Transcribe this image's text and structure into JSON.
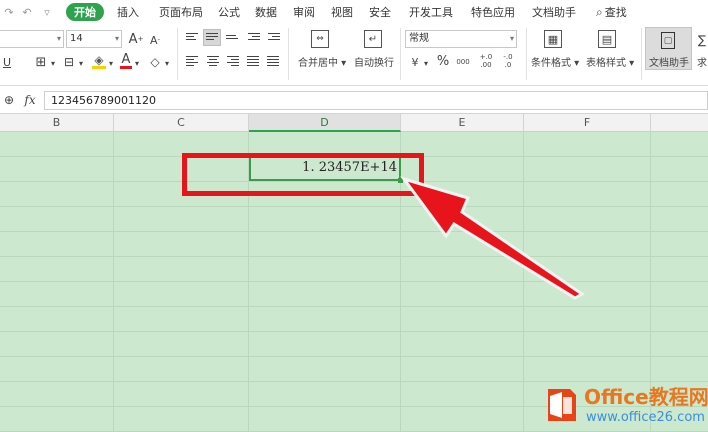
{
  "menu": {
    "items": [
      "开始",
      "插入",
      "页面布局",
      "公式",
      "数据",
      "审阅",
      "视图",
      "安全",
      "开发工具",
      "特色应用",
      "文档助手"
    ],
    "active": "开始",
    "search_label": "查找"
  },
  "ribbon": {
    "font_size": "14",
    "number_format": "常规",
    "merge_label": "合并居中",
    "wrap_label": "自动换行",
    "cond_format_label": "条件格式",
    "table_style_label": "表格样式",
    "doc_assist_label": "文档助手",
    "cut_label": "求",
    "grow_font": "A",
    "shrink_font": "A",
    "font_color": "A",
    "percent": "%",
    "comma": "000",
    "inc_decimal": "+.0 .00",
    "dec_decimal": "-.0 .0"
  },
  "formula_bar": {
    "fx_label": "fx",
    "value": "123456789001120"
  },
  "columns": [
    "B",
    "C",
    "D",
    "E",
    "F"
  ],
  "selected_column": "D",
  "cell": {
    "display": "1. 23457E+14"
  },
  "watermark": {
    "title": "Office教程网",
    "url": "www.office26.com"
  },
  "colors": {
    "accent_green": "#2fa24f",
    "grid_bg": "#cce8cf",
    "highlight_red": "#e8141b",
    "watermark_orange": "#e87722",
    "watermark_blue": "#3a8fd8"
  }
}
